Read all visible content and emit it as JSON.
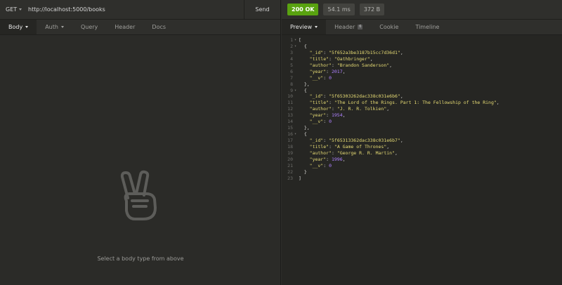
{
  "request": {
    "method": "GET",
    "url": "http://localhost:5000/books",
    "send_label": "Send",
    "tabs": [
      {
        "label": "Body",
        "active": true,
        "dropdown": true
      },
      {
        "label": "Auth",
        "active": false,
        "dropdown": true
      },
      {
        "label": "Query",
        "active": false
      },
      {
        "label": "Header",
        "active": false
      },
      {
        "label": "Docs",
        "active": false
      }
    ],
    "empty_message": "Select a body type from above"
  },
  "response": {
    "status": "200 OK",
    "time": "54.1 ms",
    "size": "372 B",
    "status_color": "#59a210",
    "tabs": [
      {
        "label": "Preview",
        "active": true,
        "dropdown": true
      },
      {
        "label": "Header",
        "badge": "6"
      },
      {
        "label": "Cookie"
      },
      {
        "label": "Timeline"
      }
    ],
    "lines": [
      "[",
      "  {",
      "    \"_id\": \"5f652a3be3187b15cc7d36d1\",",
      "    \"title\": \"Oathbringer\",",
      "    \"author\": \"Brandon Sanderson\",",
      "    \"year\": 2017,",
      "    \"__v\": 0",
      "  },",
      "  {",
      "    \"_id\": \"5f65303262dac338c031e6b6\",",
      "    \"title\": \"The Lord of the Rings. Part 1: The Fellowship of the Ring\",",
      "    \"author\": \"J. R. R. Tolkien\",",
      "    \"year\": 1954,",
      "    \"__v\": 0",
      "  },",
      "  {",
      "    \"_id\": \"5f65313362dac338c031e6b7\",",
      "    \"title\": \"A Game of Thrones\",",
      "    \"author\": \"George R. R. Martin\",",
      "    \"year\": 1996,",
      "    \"__v\": 0",
      "  }",
      "]"
    ],
    "foldable_lines": [
      1,
      2,
      9,
      16
    ]
  },
  "icons": {
    "empty_body": "peace-hand-icon"
  }
}
